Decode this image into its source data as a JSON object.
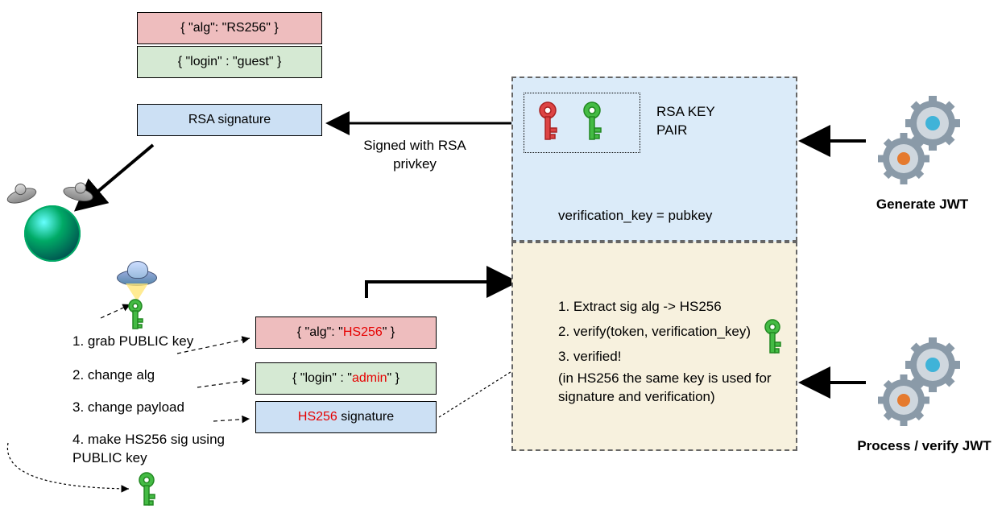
{
  "jwt_original": {
    "header_json": "{ \"alg\": \"RS256\" }",
    "payload_json": "{ \"login\" : \"guest\" }",
    "signature_label": "RSA signature"
  },
  "jwt_forged": {
    "header_prefix": "{ \"alg\": \"",
    "header_val": "HS256",
    "header_suffix": "\" }",
    "payload_prefix": "{ \"login\" : \"",
    "payload_val": "admin",
    "payload_suffix": "\" }",
    "sig_prefix": "HS256",
    "sig_suffix": " signature"
  },
  "signed_label": "Signed with RSA privkey",
  "rsa_pair_label": "RSA KEY\nPAIR",
  "verification_line": "verification_key = pubkey",
  "generate_label": "Generate JWT",
  "process_label": "Process / verify JWT",
  "attacker_steps": {
    "s1": "1. grab PUBLIC key",
    "s2": "2. change alg",
    "s3": "3. change payload",
    "s4": "4. make HS256 sig using PUBLIC key"
  },
  "verify_steps": {
    "s1": "1. Extract sig alg -> HS256",
    "s2": "2. verify(token, verification_key)",
    "s3": "3. verified!",
    "s4": "(in HS256 the same key is used for signature and verification)"
  }
}
